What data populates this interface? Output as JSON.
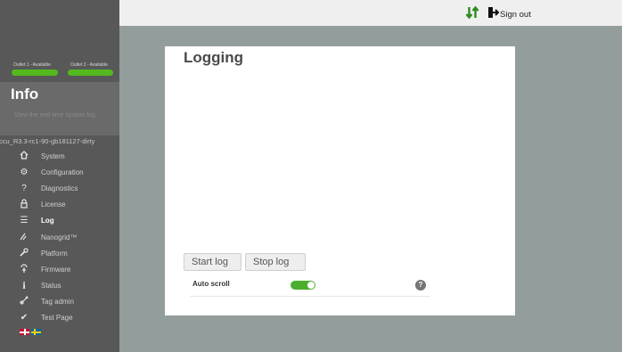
{
  "sidebar": {
    "outlets": [
      {
        "label": "Outlet 1 - Available",
        "status_color": "#53b91e"
      },
      {
        "label": "Outlet 2 - Available",
        "status_color": "#53b91e"
      }
    ],
    "section_title": "Info",
    "section_description": "View the real time system log.",
    "version": "ccu_R3.3-rc1-90-gb181127-dirty",
    "nav": [
      {
        "label": "System",
        "icon": "home-icon"
      },
      {
        "label": "Configuration",
        "icon": "gear-icon"
      },
      {
        "label": "Diagnostics",
        "icon": "question-icon"
      },
      {
        "label": "License",
        "icon": "lock-icon"
      },
      {
        "label": "Log",
        "icon": "list-icon",
        "active": true
      },
      {
        "label": "Nanogrid™",
        "icon": "nanogrid-icon"
      },
      {
        "label": "Platform",
        "icon": "wrench-icon"
      },
      {
        "label": "Firmware",
        "icon": "firmware-icon"
      },
      {
        "label": "Status",
        "icon": "info-icon"
      },
      {
        "label": "Tag admin",
        "icon": "tag-icon"
      },
      {
        "label": "Test Page",
        "icon": "check-icon"
      }
    ],
    "languages": [
      "English",
      "Swedish"
    ]
  },
  "topbar": {
    "sort_icon": "sort-arrows-icon",
    "sort_color": "#2e8b1e",
    "signout_label": "Sign out",
    "signout_icon": "sign-out-icon"
  },
  "main": {
    "title": "Logging",
    "start_label": "Start log",
    "stop_label": "Stop log",
    "autoscroll_label": "Auto scroll",
    "autoscroll_on": true,
    "help_label": "?"
  },
  "colors": {
    "accent_green": "#4cae2f",
    "sidebar_bg": "#585858",
    "content_bg": "#939d9c"
  }
}
